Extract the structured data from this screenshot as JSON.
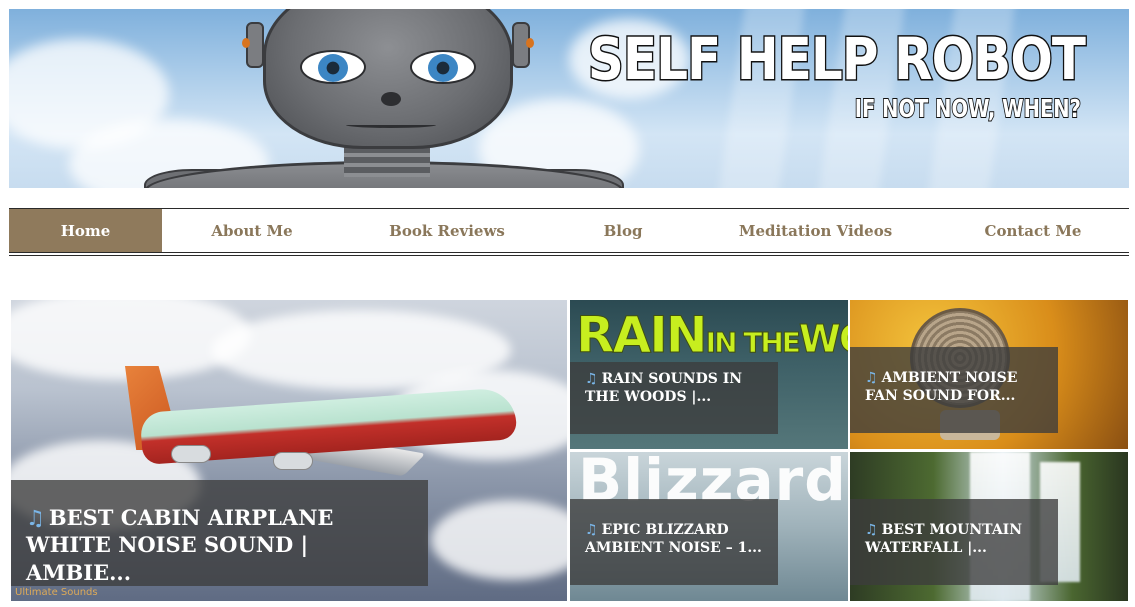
{
  "header": {
    "title": "SELF HELP ROBOT",
    "tagline": "IF NOT NOW, WHEN?"
  },
  "nav": {
    "items": [
      {
        "label": "Home",
        "active": true
      },
      {
        "label": "About Me",
        "active": false
      },
      {
        "label": "Book Reviews",
        "active": false
      },
      {
        "label": "Blog",
        "active": false
      },
      {
        "label": "Meditation Videos",
        "active": false
      },
      {
        "label": "Contact Me",
        "active": false
      }
    ]
  },
  "featured": {
    "main": {
      "title_line1": "BEST CABIN AIRPLANE",
      "title_line2": "WHITE NOISE SOUND | AMBIE...",
      "watermark": "Ultimate Sounds"
    },
    "rain": {
      "image_text_big": "RAIN",
      "image_text_small": "IN THE",
      "image_text_end": "WOODS",
      "title_line1": "RAIN SOUNDS IN",
      "title_line2": "THE WOODS |..."
    },
    "fan": {
      "title_line1": "AMBIENT NOISE",
      "title_line2": "FAN SOUND FOR..."
    },
    "blizzard": {
      "image_text": "Blizzard",
      "title_line1": "EPIC BLIZZARD",
      "title_line2": "AMBIENT NOISE – 1..."
    },
    "waterfall": {
      "title_line1": "BEST MOUNTAIN",
      "title_line2": "WATERFALL |..."
    }
  },
  "icons": {
    "video": "music-note-icon"
  },
  "colors": {
    "nav_active_bg": "#8f7a5c",
    "nav_text": "#8a775a",
    "caption_bg": "#3c3c3c"
  }
}
